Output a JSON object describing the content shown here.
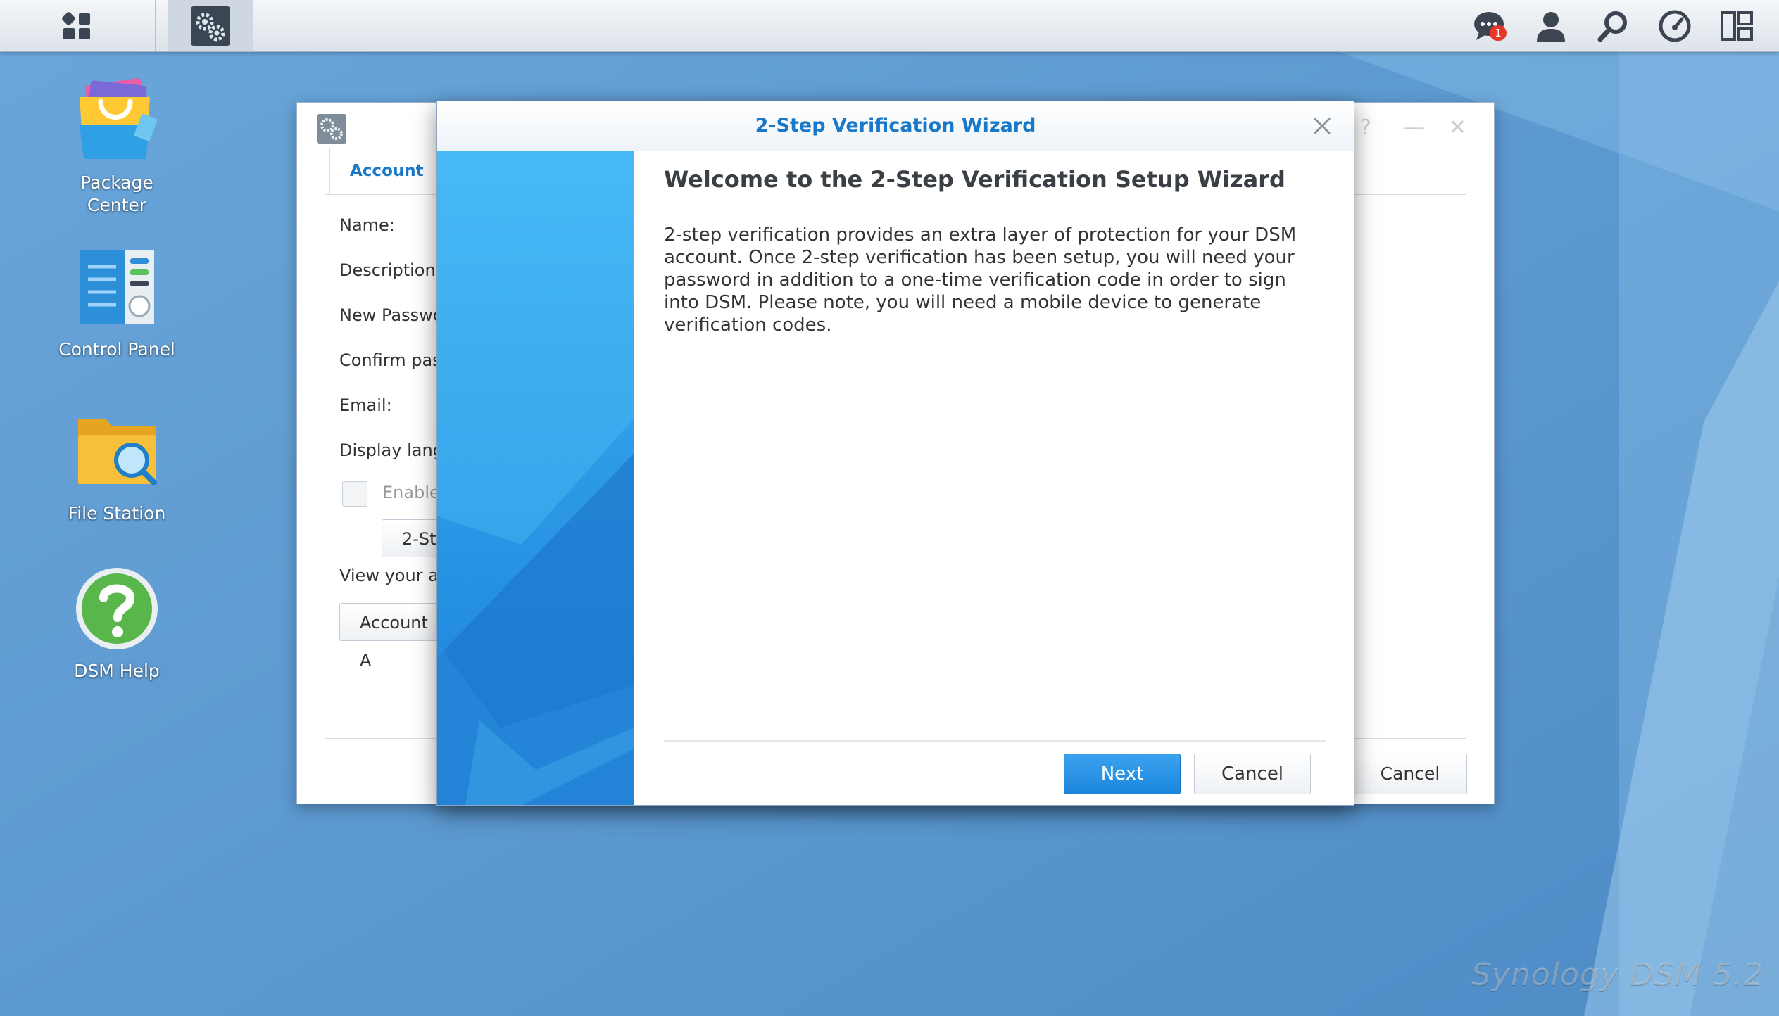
{
  "taskbar": {
    "notification_count": "1"
  },
  "desktop": {
    "icons": [
      {
        "label": "Package\nCenter"
      },
      {
        "label": "Control Panel"
      },
      {
        "label": "File Station"
      },
      {
        "label": "DSM Help"
      }
    ]
  },
  "personal_window": {
    "tab": "Account",
    "fields": [
      "Name:",
      "Description:",
      "New Passwo",
      "Confirm pas",
      "Email:",
      "Display lang"
    ],
    "enable_label": "Enable",
    "two_step_button": "2-St",
    "view_label": "View your a",
    "account_button": "Account A",
    "cancel_button": "Cancel"
  },
  "wizard": {
    "title": "2-Step Verification Wizard",
    "heading": "Welcome to the 2-Step Verification Setup Wizard",
    "body": "2-step verification provides an extra layer of protection for your DSM account. Once 2-step verification has been setup, you will need your password in addition to a one-time verification code in order to sign into DSM. Please note, you will need a mobile device to generate verification codes.",
    "next_button": "Next",
    "cancel_button": "Cancel"
  },
  "branding": {
    "text": "Synology DSM 5.2"
  },
  "colors": {
    "accent": "#1a78c8",
    "desktop": "#5b97cf",
    "badge": "#e8352a"
  }
}
